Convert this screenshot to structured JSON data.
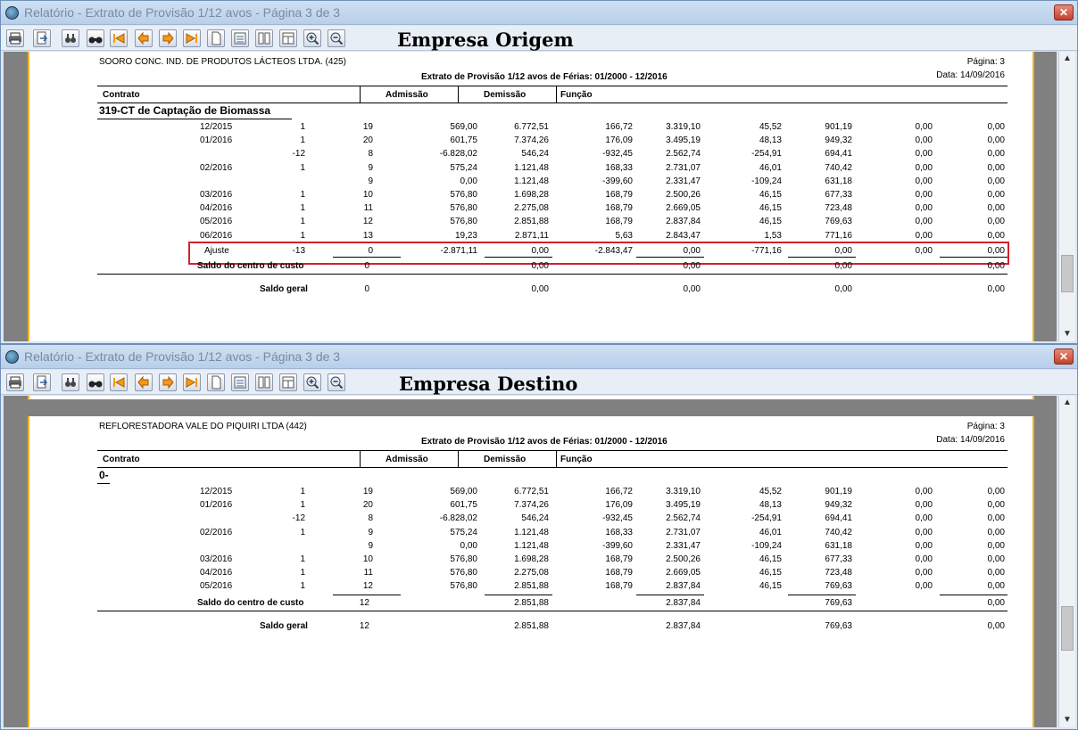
{
  "windows": [
    {
      "title": "Relatório - Extrato de Provisão 1/12 avos - Página 3 de 3",
      "company_label": "Empresa Origem",
      "report": {
        "company": "SOORO CONC. IND. DE PRODUTOS LÁCTEOS LTDA. (425)",
        "page": "Página: 3",
        "title": "Extrato de Provisão 1/12 avos de Férias: 01/2000 - 12/2016",
        "date": "Data: 14/09/2016",
        "headers": [
          "Contrato",
          "Admissão",
          "Demissão",
          "Função"
        ],
        "section": "319-CT de Captação de Biomassa",
        "rows": [
          [
            "12/2015",
            "1",
            "19",
            "569,00",
            "6.772,51",
            "166,72",
            "3.319,10",
            "45,52",
            "901,19",
            "0,00",
            "0,00"
          ],
          [
            "01/2016",
            "1",
            "20",
            "601,75",
            "7.374,26",
            "176,09",
            "3.495,19",
            "48,13",
            "949,32",
            "0,00",
            "0,00"
          ],
          [
            "",
            "-12",
            "8",
            "-6.828,02",
            "546,24",
            "-932,45",
            "2.562,74",
            "-254,91",
            "694,41",
            "0,00",
            "0,00"
          ],
          [
            "02/2016",
            "1",
            "9",
            "575,24",
            "1.121,48",
            "168,33",
            "2.731,07",
            "46,01",
            "740,42",
            "0,00",
            "0,00"
          ],
          [
            "",
            "",
            "9",
            "0,00",
            "1.121,48",
            "-399,60",
            "2.331,47",
            "-109,24",
            "631,18",
            "0,00",
            "0,00"
          ],
          [
            "03/2016",
            "1",
            "10",
            "576,80",
            "1.698,28",
            "168,79",
            "2.500,26",
            "46,15",
            "677,33",
            "0,00",
            "0,00"
          ],
          [
            "04/2016",
            "1",
            "11",
            "576,80",
            "2.275,08",
            "168,79",
            "2.669,05",
            "46,15",
            "723,48",
            "0,00",
            "0,00"
          ],
          [
            "05/2016",
            "1",
            "12",
            "576,80",
            "2.851,88",
            "168,79",
            "2.837,84",
            "46,15",
            "769,63",
            "0,00",
            "0,00"
          ],
          [
            "06/2016",
            "1",
            "13",
            "19,23",
            "2.871,11",
            "5,63",
            "2.843,47",
            "1,53",
            "771,16",
            "0,00",
            "0,00"
          ],
          [
            "Ajuste",
            "-13",
            "0",
            "-2.871,11",
            "0,00",
            "-2.843,47",
            "0,00",
            "-771,16",
            "0,00",
            "0,00",
            "0,00"
          ]
        ],
        "subtotal": [
          "Saldo do centro de custo",
          "0",
          "0,00",
          "0,00",
          "0,00",
          "0,00"
        ],
        "total": [
          "Saldo geral",
          "0",
          "0,00",
          "0,00",
          "0,00",
          "0,00"
        ]
      }
    },
    {
      "title": "Relatório - Extrato de Provisão 1/12 avos - Página 3 de 3",
      "company_label": "Empresa Destino",
      "report": {
        "company": "REFLORESTADORA VALE DO PIQUIRI LTDA (442)",
        "page": "Página: 3",
        "title": "Extrato de Provisão 1/12 avos de Férias: 01/2000 - 12/2016",
        "date": "Data: 14/09/2016",
        "headers": [
          "Contrato",
          "Admissão",
          "Demissão",
          "Função"
        ],
        "section": "0-",
        "rows": [
          [
            "12/2015",
            "1",
            "19",
            "569,00",
            "6.772,51",
            "166,72",
            "3.319,10",
            "45,52",
            "901,19",
            "0,00",
            "0,00"
          ],
          [
            "01/2016",
            "1",
            "20",
            "601,75",
            "7.374,26",
            "176,09",
            "3.495,19",
            "48,13",
            "949,32",
            "0,00",
            "0,00"
          ],
          [
            "",
            "-12",
            "8",
            "-6.828,02",
            "546,24",
            "-932,45",
            "2.562,74",
            "-254,91",
            "694,41",
            "0,00",
            "0,00"
          ],
          [
            "02/2016",
            "1",
            "9",
            "575,24",
            "1.121,48",
            "168,33",
            "2.731,07",
            "46,01",
            "740,42",
            "0,00",
            "0,00"
          ],
          [
            "",
            "",
            "9",
            "0,00",
            "1.121,48",
            "-399,60",
            "2.331,47",
            "-109,24",
            "631,18",
            "0,00",
            "0,00"
          ],
          [
            "03/2016",
            "1",
            "10",
            "576,80",
            "1.698,28",
            "168,79",
            "2.500,26",
            "46,15",
            "677,33",
            "0,00",
            "0,00"
          ],
          [
            "04/2016",
            "1",
            "11",
            "576,80",
            "2.275,08",
            "168,79",
            "2.669,05",
            "46,15",
            "723,48",
            "0,00",
            "0,00"
          ],
          [
            "05/2016",
            "1",
            "12",
            "576,80",
            "2.851,88",
            "168,79",
            "2.837,84",
            "46,15",
            "769,63",
            "0,00",
            "0,00"
          ]
        ],
        "subtotal": [
          "Saldo do centro de custo",
          "12",
          "2.851,88",
          "2.837,84",
          "769,63",
          "0,00"
        ],
        "total": [
          "Saldo geral",
          "12",
          "2.851,88",
          "2.837,84",
          "769,63",
          "0,00"
        ]
      }
    }
  ],
  "close_glyph": "✕",
  "scroll_up_glyph": "▲",
  "scroll_down_glyph": "▼",
  "toolbar_icons": [
    "print-icon",
    "export-icon",
    "find-icon",
    "find-next-icon",
    "first-page-icon",
    "prev-page-icon",
    "next-page-icon",
    "last-page-icon",
    "page-icon",
    "page-width-icon",
    "two-pages-icon",
    "multi-page-icon",
    "zoom-in-icon",
    "zoom-out-icon"
  ],
  "colors": {
    "highlight": "#d6202a",
    "page_border": "#f4b11c"
  }
}
